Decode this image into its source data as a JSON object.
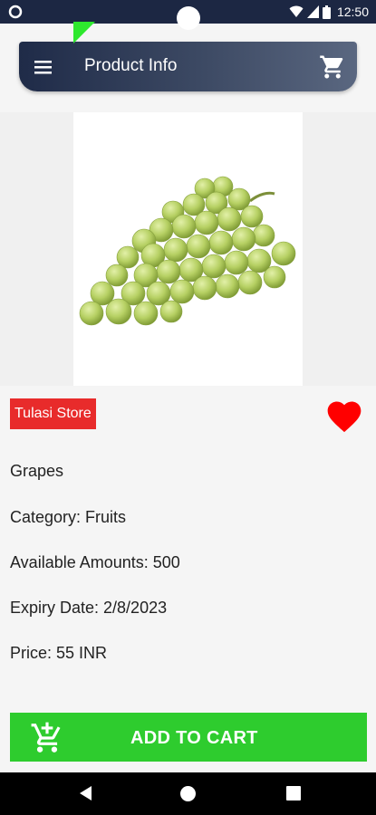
{
  "status_bar": {
    "time": "12:50",
    "icons": [
      "circle-notification-icon",
      "wifi-icon",
      "signal-icon",
      "battery-icon"
    ]
  },
  "app_bar": {
    "title": "Product Info",
    "menu_icon": "hamburger-menu-icon",
    "cart_icon": "shopping-cart-icon"
  },
  "product": {
    "image": "grapes-bunch",
    "store": "Tulasi Store",
    "favorite_icon": "heart-icon",
    "name": "Grapes",
    "category": "Category: Fruits",
    "amount": "Available Amounts: 500",
    "expiry": "Expiry Date: 2/8/2023",
    "price": "Price: 55 INR"
  },
  "actions": {
    "add_to_cart_label": "ADD TO CART"
  },
  "nav_bar": {
    "icons": [
      "back-icon",
      "home-icon",
      "recents-icon"
    ]
  },
  "colors": {
    "status_bar": "#1c2743",
    "app_bar_start": "#1f2b48",
    "store_badge": "#e82b2b",
    "heart": "#ff0000",
    "add_to_cart": "#2ecc2e",
    "corner_tag": "#2ee82e"
  }
}
